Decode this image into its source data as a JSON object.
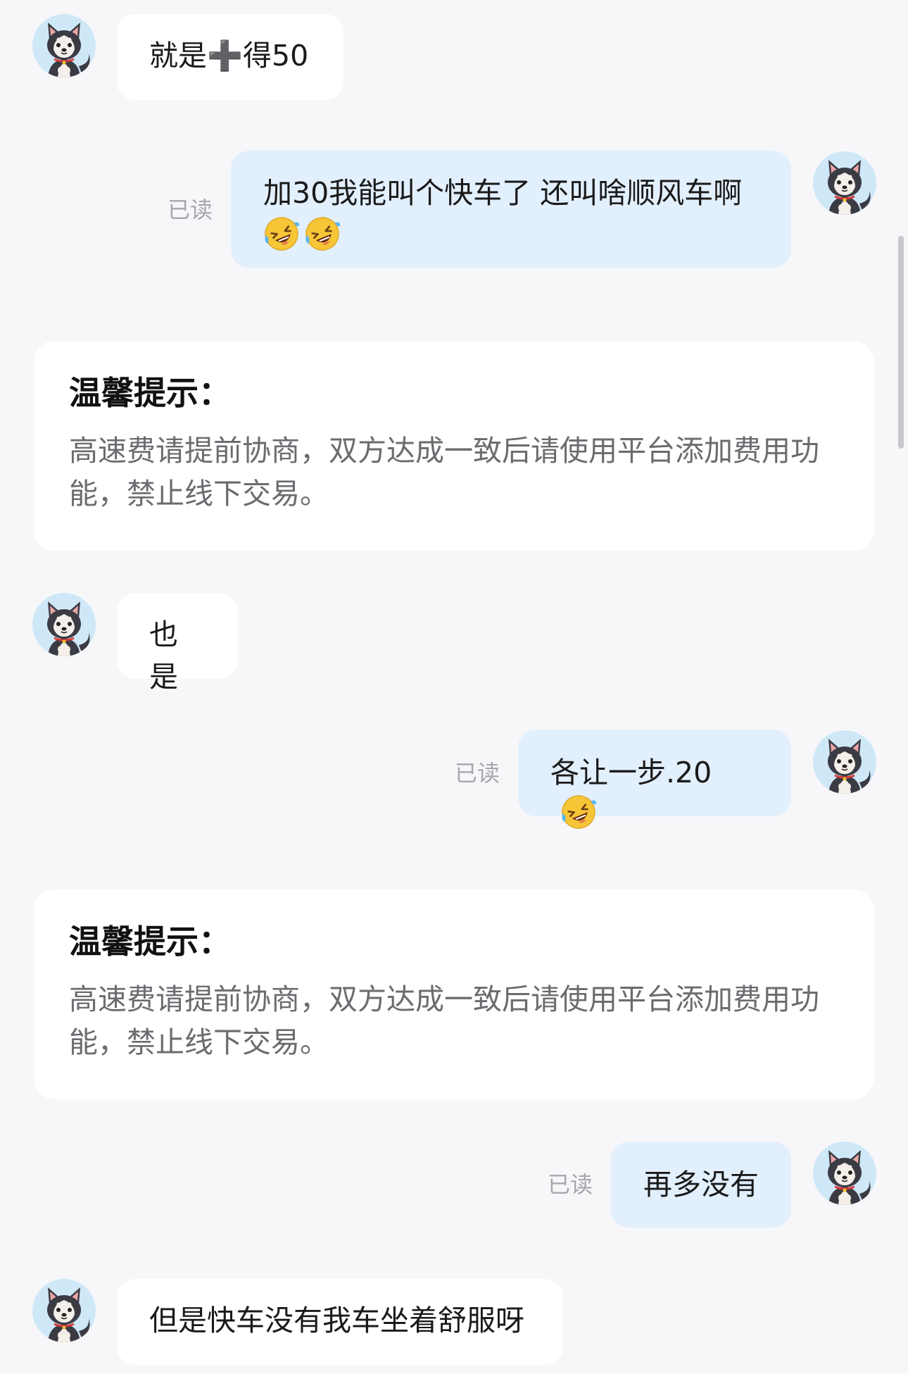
{
  "messages": [
    {
      "side": "in",
      "text": "就是➕得50"
    },
    {
      "side": "out",
      "read": "已读",
      "text_line1": "加30我能叫个快车了 还叫啥顺风车啊",
      "emoji": "rolling-on-floor-laughing",
      "emoji_count": 2
    },
    {
      "side": "system",
      "title": "温馨提示：",
      "body": "高速费请提前协商，双方达成一致后请使用平台添加费用功能，禁止线下交易。"
    },
    {
      "side": "in",
      "text": "也是"
    },
    {
      "side": "out",
      "read": "已读",
      "text": "各让一步.20",
      "emoji": "rolling-on-floor-laughing",
      "emoji_count": 1
    },
    {
      "side": "system",
      "title": "温馨提示：",
      "body": "高速费请提前协商，双方达成一致后请使用平台添加费用功能，禁止线下交易。"
    },
    {
      "side": "out",
      "read": "已读",
      "text": "再多没有"
    },
    {
      "side": "in",
      "text": "但是快车没有我车坐着舒服呀"
    }
  ],
  "colors": {
    "background": "#f7f7fa",
    "incoming_bubble": "#ffffff",
    "outgoing_bubble": "#e2effc",
    "read_receipt": "#a7a7ab",
    "tip_body": "#6b6b70"
  }
}
